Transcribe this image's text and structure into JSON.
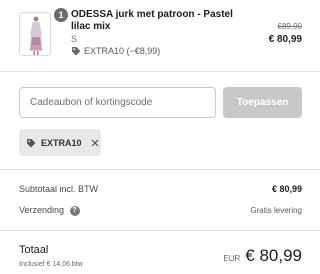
{
  "product": {
    "quantity": "1",
    "name": "ODESSA jurk met patroon - Pastel lilac mix",
    "variant": "S",
    "discount_label": "EXTRA10 (−€8,99)",
    "old_price": "€89,90",
    "price": "€ 80,99",
    "icons": {
      "discount": "tag-icon"
    }
  },
  "discount_form": {
    "placeholder": "Cadeaubon of kortingscode",
    "apply_label": "Toepassen"
  },
  "applied_code": {
    "code": "EXTRA10",
    "icons": {
      "tag": "tag-icon",
      "remove": "close-icon"
    }
  },
  "summary": {
    "subtotal_label": "Subtotaal incl. BTW",
    "subtotal_value": "€ 80,99",
    "shipping_label": "Verzending",
    "shipping_help_icon": "help-icon",
    "shipping_value": "Gratis levering"
  },
  "total": {
    "label": "Totaal",
    "tax_note": "Inclusief € 14,06 btw",
    "currency": "EUR",
    "amount": "€ 80,99"
  },
  "colors": {
    "button_disabled": "#c8c8c8",
    "badge": "#6b6b6b",
    "chip_bg": "#e8e8e8"
  }
}
